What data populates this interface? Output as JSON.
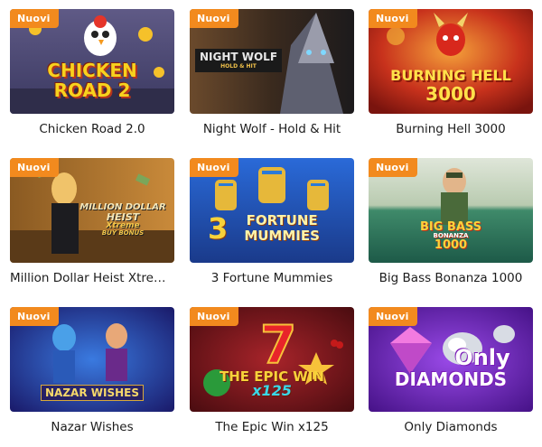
{
  "badge_label": "Nuovi",
  "games": [
    {
      "title": "Chicken Road 2.0",
      "logo_lines": [
        "CHICKEN",
        "ROAD 2"
      ]
    },
    {
      "title": "Night Wolf - Hold & Hit",
      "logo_lines": [
        "NIGHT WOLF",
        "HOLD & HIT"
      ]
    },
    {
      "title": "Burning Hell 3000",
      "logo_lines": [
        "BURNING HELL",
        "3000"
      ]
    },
    {
      "title": "Million Dollar Heist Xtreme Bu...",
      "logo_lines": [
        "MILLION DOLLAR",
        "HEIST",
        "Xtreme",
        "BUY BONUS"
      ]
    },
    {
      "title": "3 Fortune Mummies",
      "logo_lines": [
        "3",
        "FORTUNE",
        "MUMMIES"
      ]
    },
    {
      "title": "Big Bass Bonanza 1000",
      "logo_lines": [
        "BIG BASS",
        "BONANZA",
        "1000"
      ]
    },
    {
      "title": "Nazar Wishes",
      "logo_lines": [
        "NAZAR WISHES"
      ]
    },
    {
      "title": "The Epic Win x125",
      "logo_lines": [
        "THE EPIC WIN",
        "x125"
      ]
    },
    {
      "title": "Only Diamonds",
      "logo_lines": [
        "Only",
        "DIAMONDS"
      ]
    }
  ]
}
